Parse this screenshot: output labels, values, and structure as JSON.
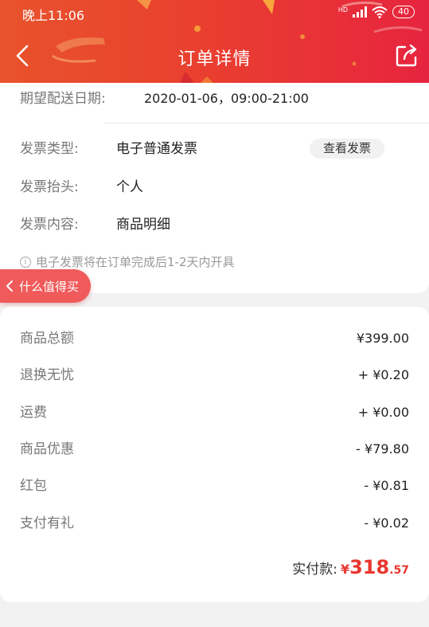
{
  "status_bar": {
    "time": "晚上11:06",
    "network": "HD",
    "battery": "40"
  },
  "nav": {
    "title": "订单详情"
  },
  "delivery": {
    "label": "期望配送日期:",
    "value": "2020-01-06，09:00-21:00"
  },
  "invoice": {
    "type_label": "发票类型:",
    "type_value": "电子普通发票",
    "view_button": "查看发票",
    "title_label": "发票抬头:",
    "title_value": "个人",
    "content_label": "发票内容:",
    "content_value": "商品明细",
    "notice": "电子发票将在订单完成后1-2天内开具"
  },
  "floating_pill": {
    "label": "什么值得买"
  },
  "price": {
    "rows": [
      {
        "label": "商品总额",
        "amount": "¥399.00"
      },
      {
        "label": "退换无忧",
        "amount": "+ ¥0.20"
      },
      {
        "label": "运费",
        "amount": "+ ¥0.00"
      },
      {
        "label": "商品优惠",
        "amount": "- ¥79.80"
      },
      {
        "label": "红包",
        "amount": "- ¥0.81"
      },
      {
        "label": "支付有礼",
        "amount": "- ¥0.02"
      }
    ],
    "total_label": "实付款:",
    "total_currency": "¥",
    "total_integer": "318",
    "total_decimal": ".57"
  },
  "colors": {
    "brand_red": "#e8372f",
    "header_start": "#e8532c",
    "header_end": "#e7243f",
    "pill": "#f05a5a"
  }
}
